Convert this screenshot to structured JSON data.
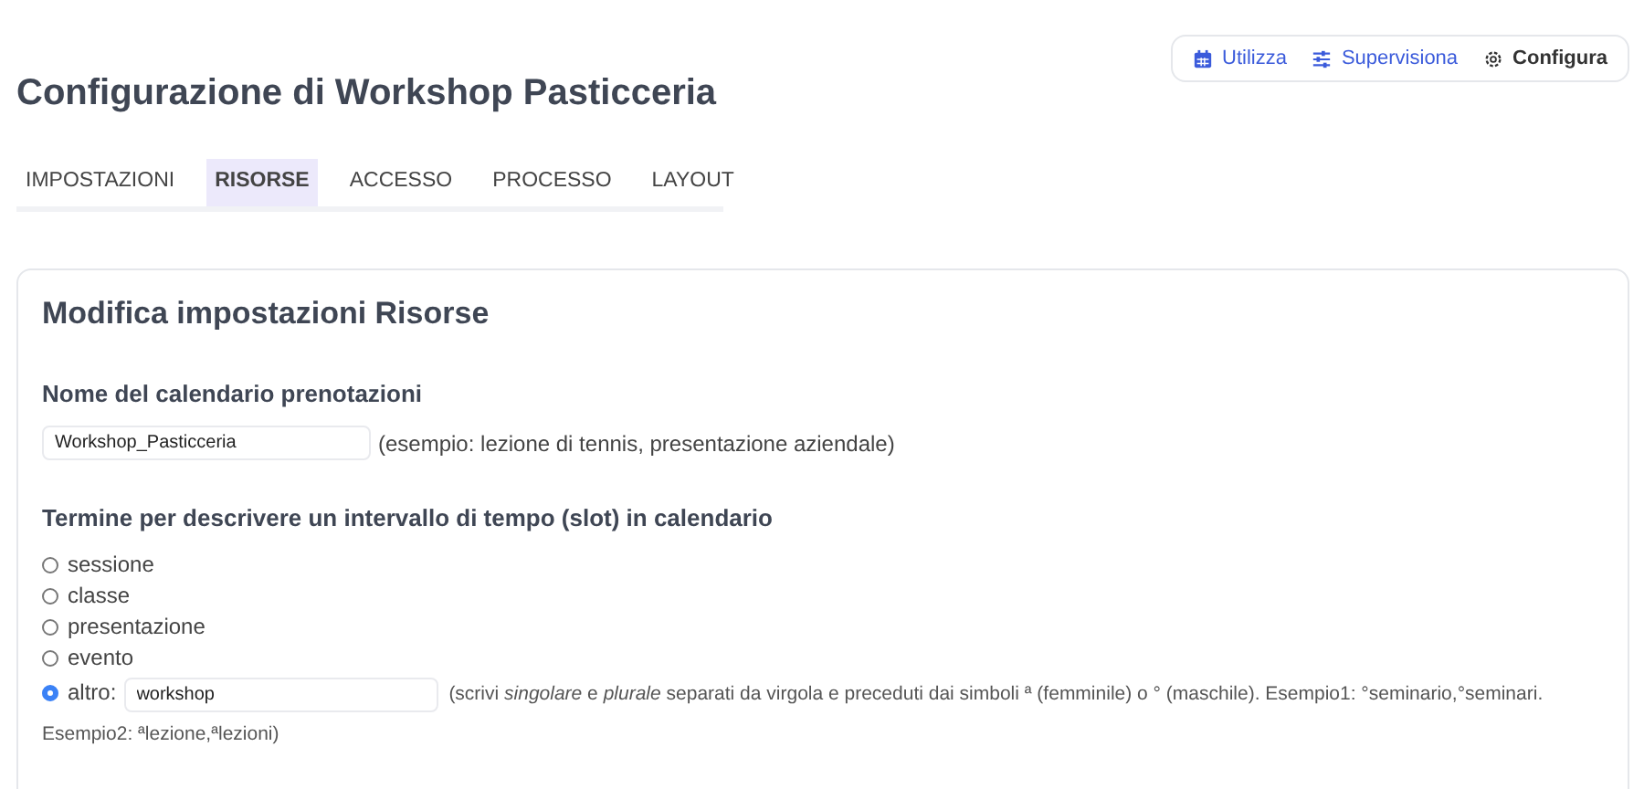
{
  "title": "Configurazione di Workshop Pasticceria",
  "modes": [
    {
      "kind": "calendar",
      "label": "Utilizza",
      "selected": false
    },
    {
      "kind": "sliders",
      "label": "Supervisiona",
      "selected": false
    },
    {
      "kind": "gear",
      "label": "Configura",
      "selected": true
    }
  ],
  "tabs": [
    {
      "label": "IMPOSTAZIONI",
      "selected": false
    },
    {
      "label": "RISORSE",
      "selected": true
    },
    {
      "label": "ACCESSO",
      "selected": false
    },
    {
      "label": "PROCESSO",
      "selected": false
    },
    {
      "label": "LAYOUT",
      "selected": false
    }
  ],
  "card": {
    "title": "Modifica impostazioni Risorse",
    "calendar_name": {
      "label": "Nome del calendario prenotazioni",
      "value": "Workshop_Pasticceria",
      "hint": "(esempio: lezione di tennis, presentazione aziendale)"
    },
    "slot_term": {
      "label": "Termine per descrivere un intervallo di tempo (slot) in calendario",
      "options": [
        {
          "label": "sessione",
          "selected": false
        },
        {
          "label": "classe",
          "selected": false
        },
        {
          "label": "presentazione",
          "selected": false
        },
        {
          "label": "evento",
          "selected": false
        },
        {
          "label": "altro:",
          "selected": true,
          "value": "workshop",
          "hint": "(scrivi *singolare* e *plurale* separati da virgola e preceduti dai simboli ª (femminile) o ° (maschile). Esempio1: °seminario,°seminari.",
          "hint_continued": "Esempio2: ªlezione,ªlezioni)"
        }
      ]
    }
  }
}
